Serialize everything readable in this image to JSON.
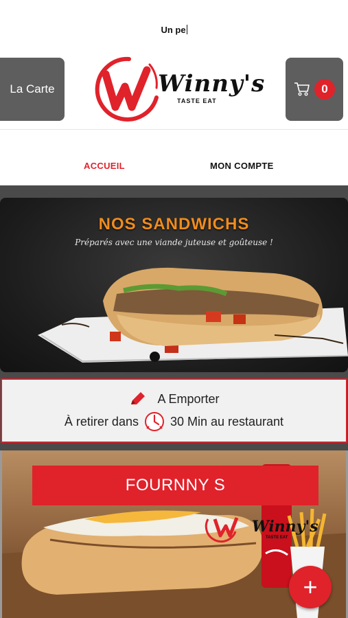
{
  "status": {
    "text": "Un pe"
  },
  "header": {
    "menu_button_label": "La Carte",
    "cart_count": "0",
    "logo": {
      "name": "Winny's",
      "tagline": "TASTE EAT"
    }
  },
  "nav": {
    "tabs": [
      {
        "label": "ACCUEIL",
        "active": true
      },
      {
        "label": "MON COMPTE",
        "active": false
      }
    ]
  },
  "banner": {
    "title": "NOS SANDWICHS",
    "subtitle": "Préparés avec une viande juteuse et goûteuse !"
  },
  "takeaway": {
    "mode": "A Emporter",
    "prefix": "À retirer dans",
    "time": "30 Min au restaurant"
  },
  "product": {
    "title": "FOURNNY S",
    "logo": {
      "name": "Winny's",
      "tagline": "TASTE EAT"
    },
    "add_label": "+"
  },
  "colors": {
    "accent": "#e0222b",
    "button_gray": "#5e5e5e",
    "banner_title": "#f08c1e"
  },
  "icons": [
    "cart-icon",
    "pencil-icon",
    "clock-icon",
    "plus-icon",
    "logo-w-icon"
  ]
}
